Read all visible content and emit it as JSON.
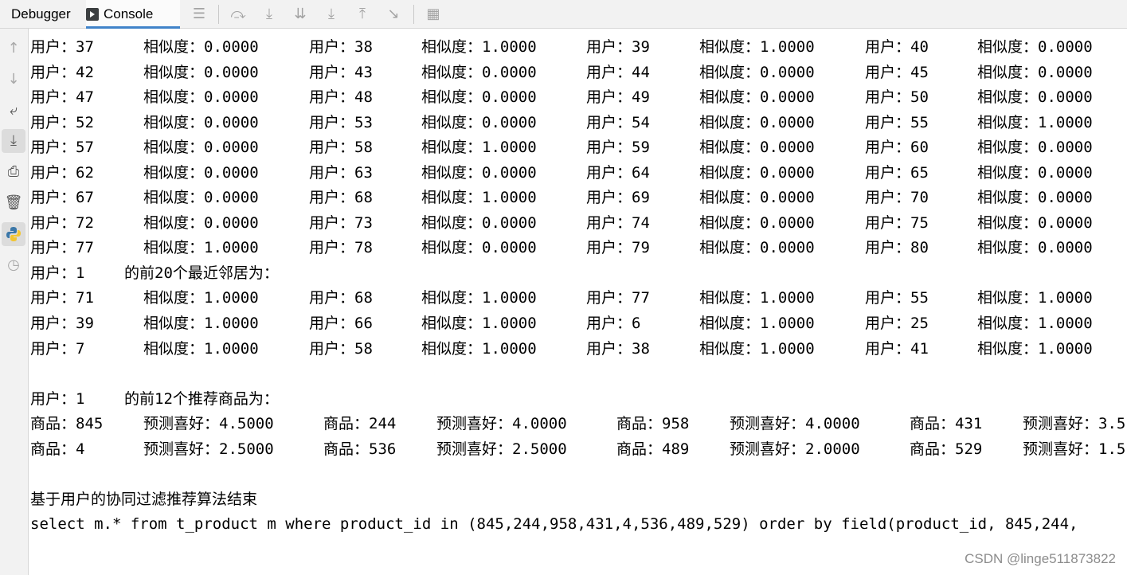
{
  "tabs": {
    "debugger": "Debugger",
    "console": "Console"
  },
  "toolbar_icons": [
    "menu-icon",
    "step-over-icon",
    "step-into-icon",
    "step-into-my-code-icon",
    "step-out-icon",
    "step-up-icon",
    "run-to-cursor-icon",
    "evaluate-icon"
  ],
  "gutter_icons": [
    "up-arrow-icon",
    "down-arrow-icon",
    "soft-wrap-icon",
    "scroll-to-end-icon",
    "print-icon",
    "trash-icon",
    "python-console-icon",
    "history-icon"
  ],
  "output": {
    "similarity_rows": [
      [
        [
          "用户：37",
          "相似度：0.0000"
        ],
        [
          "用户：38",
          "相似度：1.0000"
        ],
        [
          "用户：39",
          "相似度：1.0000"
        ],
        [
          "用户：40",
          "相似度：0.0000"
        ]
      ],
      [
        [
          "用户：42",
          "相似度：0.0000"
        ],
        [
          "用户：43",
          "相似度：0.0000"
        ],
        [
          "用户：44",
          "相似度：0.0000"
        ],
        [
          "用户：45",
          "相似度：0.0000"
        ]
      ],
      [
        [
          "用户：47",
          "相似度：0.0000"
        ],
        [
          "用户：48",
          "相似度：0.0000"
        ],
        [
          "用户：49",
          "相似度：0.0000"
        ],
        [
          "用户：50",
          "相似度：0.0000"
        ]
      ],
      [
        [
          "用户：52",
          "相似度：0.0000"
        ],
        [
          "用户：53",
          "相似度：0.0000"
        ],
        [
          "用户：54",
          "相似度：0.0000"
        ],
        [
          "用户：55",
          "相似度：1.0000"
        ]
      ],
      [
        [
          "用户：57",
          "相似度：0.0000"
        ],
        [
          "用户：58",
          "相似度：1.0000"
        ],
        [
          "用户：59",
          "相似度：0.0000"
        ],
        [
          "用户：60",
          "相似度：0.0000"
        ]
      ],
      [
        [
          "用户：62",
          "相似度：0.0000"
        ],
        [
          "用户：63",
          "相似度：0.0000"
        ],
        [
          "用户：64",
          "相似度：0.0000"
        ],
        [
          "用户：65",
          "相似度：0.0000"
        ]
      ],
      [
        [
          "用户：67",
          "相似度：0.0000"
        ],
        [
          "用户：68",
          "相似度：1.0000"
        ],
        [
          "用户：69",
          "相似度：0.0000"
        ],
        [
          "用户：70",
          "相似度：0.0000"
        ]
      ],
      [
        [
          "用户：72",
          "相似度：0.0000"
        ],
        [
          "用户：73",
          "相似度：0.0000"
        ],
        [
          "用户：74",
          "相似度：0.0000"
        ],
        [
          "用户：75",
          "相似度：0.0000"
        ]
      ],
      [
        [
          "用户：77",
          "相似度：1.0000"
        ],
        [
          "用户：78",
          "相似度：0.0000"
        ],
        [
          "用户：79",
          "相似度：0.0000"
        ],
        [
          "用户：80",
          "相似度：0.0000"
        ]
      ]
    ],
    "neighbors_header": {
      "user": "用户：1",
      "text": "的前20个最近邻居为："
    },
    "neighbor_rows": [
      [
        [
          "用户：71",
          "相似度：1.0000"
        ],
        [
          "用户：68",
          "相似度：1.0000"
        ],
        [
          "用户：77",
          "相似度：1.0000"
        ],
        [
          "用户：55",
          "相似度：1.0000"
        ]
      ],
      [
        [
          "用户：39",
          "相似度：1.0000"
        ],
        [
          "用户：66",
          "相似度：1.0000"
        ],
        [
          "用户：6",
          "相似度：1.0000"
        ],
        [
          "用户：25",
          "相似度：1.0000"
        ]
      ],
      [
        [
          "用户：7",
          "相似度：1.0000"
        ],
        [
          "用户：58",
          "相似度：1.0000"
        ],
        [
          "用户：38",
          "相似度：1.0000"
        ],
        [
          "用户：41",
          "相似度：1.0000"
        ]
      ]
    ],
    "recommend_header": {
      "user": "用户：1",
      "text": "的前12个推荐商品为："
    },
    "recommend_rows": [
      [
        [
          "商品：845",
          "预测喜好：4.5000"
        ],
        [
          "商品：244",
          "预测喜好：4.0000"
        ],
        [
          "商品：958",
          "预测喜好：4.0000"
        ],
        [
          "商品：431",
          "预测喜好：3.5"
        ]
      ],
      [
        [
          "商品：4",
          "预测喜好：2.5000"
        ],
        [
          "商品：536",
          "预测喜好：2.5000"
        ],
        [
          "商品：489",
          "预测喜好：2.0000"
        ],
        [
          "商品：529",
          "预测喜好：1.5"
        ]
      ]
    ],
    "end_line": "基于用户的协同过滤推荐算法结束",
    "sql_line": "select m.* from t_product m where product_id in (845,244,958,431,4,536,489,529) order by field(product_id, 845,244,"
  },
  "watermark": "CSDN @linge511873822"
}
